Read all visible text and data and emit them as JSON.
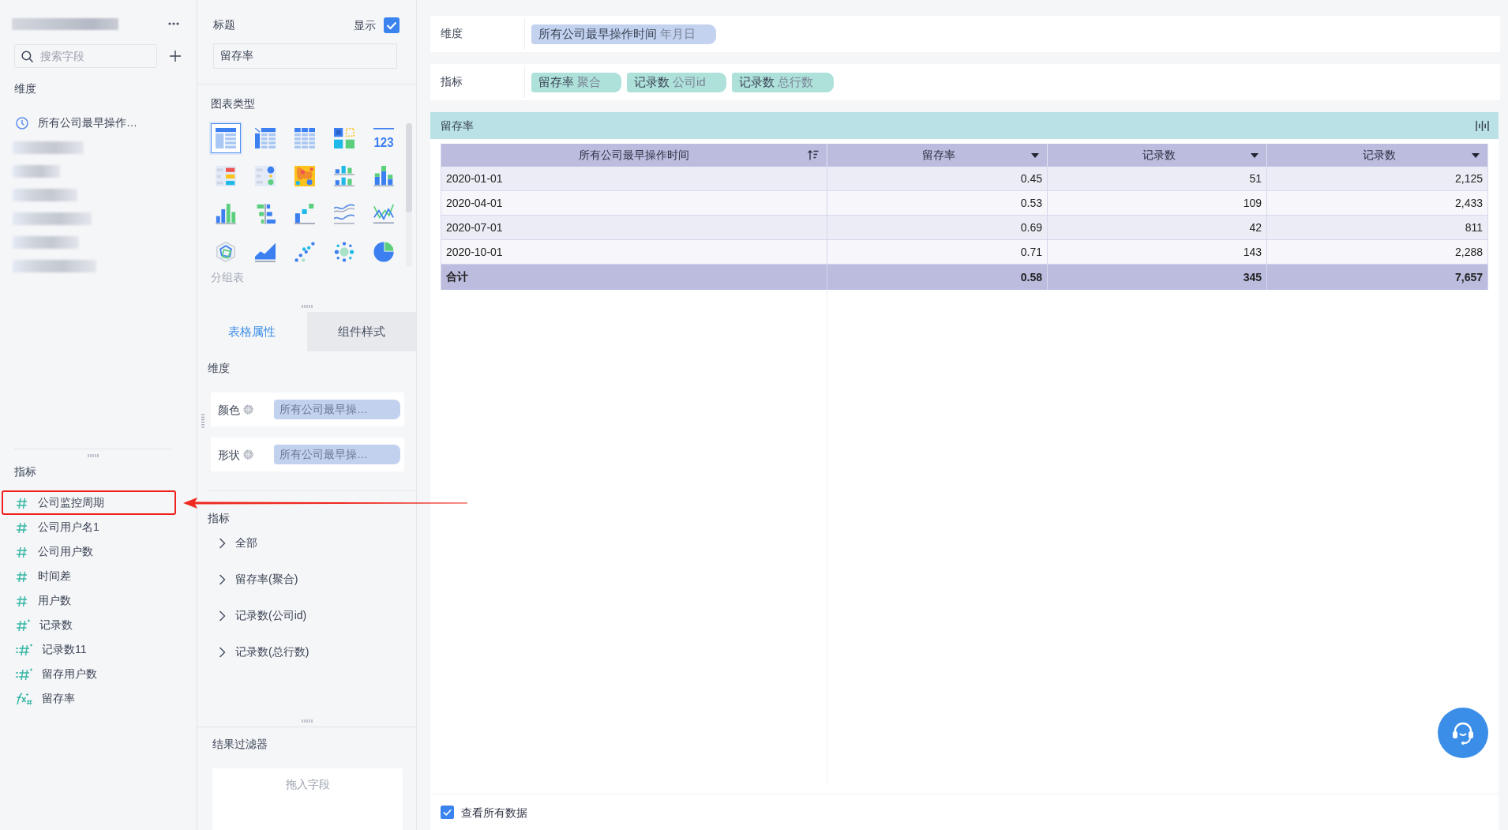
{
  "field_panel": {
    "search": {
      "placeholder": "搜索字段"
    },
    "dimension_heading": "维度",
    "dimension_fields": [
      {
        "label": "所有公司最早操作…",
        "kind": "date"
      }
    ],
    "metric_heading": "指标",
    "metric_fields": [
      {
        "label": "公司监控周期",
        "kind": "number",
        "highlighted": true
      },
      {
        "label": "公司用户名1",
        "kind": "number",
        "highlighted": false
      },
      {
        "label": "公司用户数",
        "kind": "number",
        "highlighted": false
      },
      {
        "label": "时间差",
        "kind": "number",
        "highlighted": false
      },
      {
        "label": "用户数",
        "kind": "number",
        "highlighted": false
      },
      {
        "label": "记录数",
        "kind": "number-star",
        "highlighted": false
      },
      {
        "label": "记录数11",
        "kind": "number-linked",
        "highlighted": false
      },
      {
        "label": "留存用户数",
        "kind": "number-linked",
        "highlighted": false
      },
      {
        "label": "留存率",
        "kind": "formula",
        "highlighted": false
      }
    ]
  },
  "config_panel": {
    "title_heading": "标题",
    "show_title_label": "显示",
    "show_title": true,
    "title_value": "留存率",
    "chart_type_heading": "图表类型",
    "chart_types": [
      {
        "kind": "table",
        "selected": true
      },
      {
        "kind": "pivot-table",
        "selected": false
      },
      {
        "kind": "grid-table",
        "selected": false
      },
      {
        "kind": "color-blocks",
        "selected": false
      },
      {
        "kind": "kpi",
        "glyph": "123",
        "selected": false
      },
      {
        "kind": "kpi-list",
        "selected": false
      },
      {
        "kind": "dot-list",
        "selected": false
      },
      {
        "kind": "heatmap",
        "selected": false
      },
      {
        "kind": "split-bar",
        "selected": false
      },
      {
        "kind": "stacked-bar",
        "selected": false
      },
      {
        "kind": "bar",
        "selected": false
      },
      {
        "kind": "diverging-bar",
        "selected": false
      },
      {
        "kind": "step-bar",
        "selected": false
      },
      {
        "kind": "wave-lines",
        "selected": false
      },
      {
        "kind": "line",
        "selected": false
      },
      {
        "kind": "radar",
        "selected": false
      },
      {
        "kind": "area",
        "selected": false
      },
      {
        "kind": "scatter",
        "selected": false
      },
      {
        "kind": "bubble",
        "selected": false
      },
      {
        "kind": "pie",
        "selected": false
      }
    ],
    "chart_type_caption": "分组表",
    "tabs": [
      {
        "label": "表格属性",
        "selected": true
      },
      {
        "label": "组件样式",
        "selected": false
      }
    ],
    "dimension_heading": "维度",
    "encodings": [
      {
        "label": "颜色",
        "field": "所有公司最早操…"
      },
      {
        "label": "形状",
        "field": "所有公司最早操…"
      }
    ],
    "metric_heading": "指标",
    "metric_tree": [
      {
        "label": "全部",
        "expanded": false
      },
      {
        "label": "留存率(聚合)",
        "expanded": false
      },
      {
        "label": "记录数(公司id)",
        "expanded": false
      },
      {
        "label": "记录数(总行数)",
        "expanded": false
      }
    ],
    "filter_heading": "结果过滤器",
    "filter_drop": {
      "placeholder": "拖入字段"
    }
  },
  "shelves": [
    {
      "label": "维度",
      "kind": "dimension",
      "pills": [
        {
          "name": "所有公司最早操作时间",
          "detail": "年月日"
        }
      ]
    },
    {
      "label": "指标",
      "kind": "metric",
      "pills": [
        {
          "name": "留存率",
          "detail": "聚合"
        },
        {
          "name": "记录数",
          "detail": "公司id"
        },
        {
          "name": "记录数",
          "detail": "总行数"
        }
      ]
    }
  ],
  "widget": {
    "title": "留存率",
    "table": {
      "columns": [
        {
          "label": "所有公司最早操作时间",
          "kind": "sort"
        },
        {
          "label": "留存率",
          "kind": "menu"
        },
        {
          "label": "记录数",
          "kind": "menu"
        },
        {
          "label": "记录数",
          "kind": "menu"
        }
      ],
      "rows": [
        [
          "2020-01-01",
          "0.45",
          "51",
          "2,125"
        ],
        [
          "2020-04-01",
          "0.53",
          "109",
          "2,433"
        ],
        [
          "2020-07-01",
          "0.69",
          "42",
          "811"
        ],
        [
          "2020-10-01",
          "0.71",
          "143",
          "2,288"
        ]
      ],
      "total": [
        "合计",
        "0.58",
        "345",
        "7,657"
      ]
    }
  },
  "footer": {
    "view_all_label": "查看所有数据",
    "view_all_checked": true
  }
}
